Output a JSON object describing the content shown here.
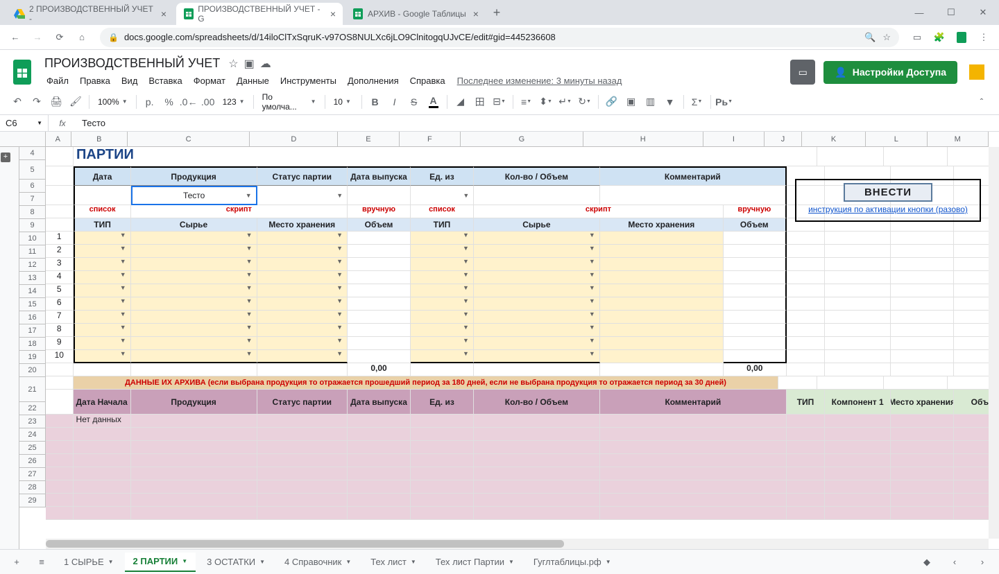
{
  "browser": {
    "tabs": [
      {
        "title": "2 ПРОИЗВОДСТВЕННЫЙ УЧЕТ -",
        "icon": "drive",
        "active": false
      },
      {
        "title": "ПРОИЗВОДСТВЕННЫЙ УЧЕТ - G",
        "icon": "sheets",
        "active": true
      },
      {
        "title": "АРХИВ - Google Таблицы",
        "icon": "sheets",
        "active": false
      }
    ],
    "url": "docs.google.com/spreadsheets/d/14iloClTxSqruK-v97OS8NULXc6jLO9ClnitogqUJvCE/edit#gid=445236608"
  },
  "doc": {
    "title": "ПРОИЗВОДСТВЕННЫЙ УЧЕТ",
    "menus": [
      "Файл",
      "Правка",
      "Вид",
      "Вставка",
      "Формат",
      "Данные",
      "Инструменты",
      "Дополнения",
      "Справка"
    ],
    "last_edit": "Последнее изменение: 3 минуты назад",
    "share": "Настройки Доступа"
  },
  "toolbar": {
    "zoom": "100%",
    "currency": "р.",
    "font": "По умолча...",
    "font_size": "10"
  },
  "formula": {
    "cell_ref": "C6",
    "value": "Тесто"
  },
  "columns": [
    "A",
    "B",
    "C",
    "D",
    "E",
    "F",
    "G",
    "H",
    "I",
    "J",
    "K",
    "L",
    "M"
  ],
  "rows_visible": [
    4,
    5,
    6,
    7,
    8,
    9,
    10,
    11,
    12,
    13,
    14,
    15,
    16,
    17,
    18,
    19,
    20,
    21,
    22,
    23,
    24,
    25,
    26,
    27,
    28,
    29
  ],
  "data_nums": [
    "1",
    "2",
    "3",
    "4",
    "5",
    "6",
    "7",
    "8",
    "9",
    "10"
  ],
  "content": {
    "title": "ПАРТИИ",
    "headers1": [
      "Дата",
      "Продукция",
      "Статус партии",
      "Дата выпуска",
      "Ед. из",
      "Кол-во / Объем",
      "Комментарий"
    ],
    "selected_product": "Тесто",
    "hints": {
      "list": "список",
      "script": "скрипт",
      "manual": "вручную"
    },
    "headers2_left": [
      "ТИП",
      "Сырье",
      "Место хранения",
      "Объем"
    ],
    "headers2_right": [
      "ТИП",
      "Сырье",
      "Место хранения",
      "Объем"
    ],
    "sum": "0,00",
    "archive_banner": "ДАННЫЕ ИХ АРХИВА (если выбрана продукция то отражается прошедший период за 180 дней, если не выбрана продукция то отражается период за 30 дней)",
    "archive_headers": [
      "Дата Начала",
      "Продукция",
      "Статус партии",
      "Дата выпуска",
      "Ед. из",
      "Кол-во / Объем",
      "Комментарий"
    ],
    "archive_headers_right": [
      "ТИП",
      "Компонент 1",
      "Место хранения",
      "Объем"
    ],
    "no_data": "Нет данных",
    "vnesti": "ВНЕСТИ",
    "instruction": "инструкция по активации кнопки (разово)"
  },
  "sheet_tabs": [
    "1 СЫРЬЕ",
    "2 ПАРТИИ",
    "3 ОСТАТКИ",
    "4 Справочник",
    "Тех лист",
    "Тех лист Партии",
    "Гуглтаблицы.рф"
  ],
  "active_sheet": 1
}
